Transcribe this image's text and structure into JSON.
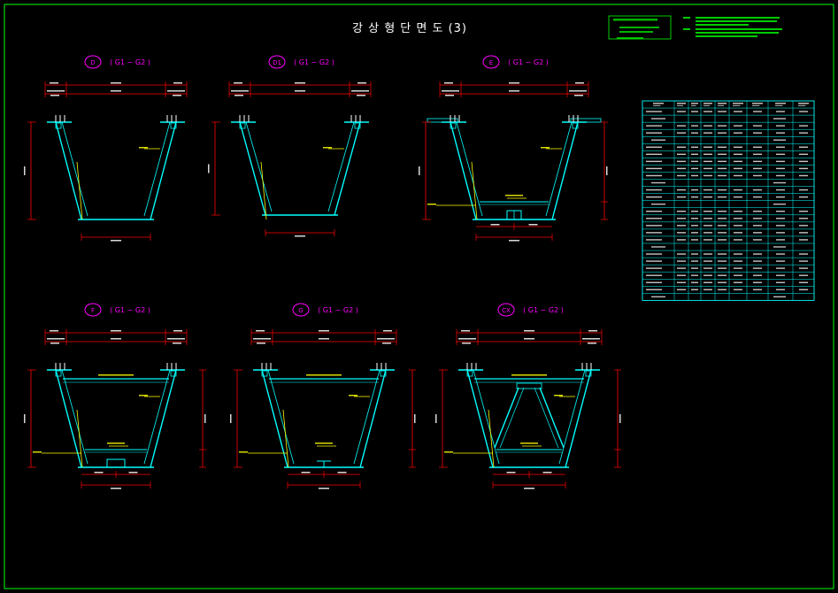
{
  "title": "강 상 형 단 면 도 (3)",
  "colors": {
    "background": "#000000",
    "frame": "#00ff00",
    "section": "#00ffff",
    "dimension": "#ff0000",
    "note": "#ffff00",
    "label": "#ff00ff",
    "table": "#00ffff",
    "text": "#ffffff"
  },
  "sections": [
    {
      "id": "sec-d",
      "mark": "D",
      "range": "( G1 ~ G2 )",
      "bracing": "none"
    },
    {
      "id": "sec-d1",
      "mark": "D1",
      "range": "( G1 ~ G2 )",
      "bracing": "none"
    },
    {
      "id": "sec-e",
      "mark": "E",
      "range": "( G1 ~ G2 )",
      "bracing": "bottom"
    },
    {
      "id": "sec-f",
      "mark": "F",
      "range": "( G1 ~ G2 )",
      "bracing": "strut-bottom"
    },
    {
      "id": "sec-g",
      "mark": "G",
      "range": "( G1 ~ G2 )",
      "bracing": "strut"
    },
    {
      "id": "sec-cx",
      "mark": "CX",
      "range": "( G1 ~ G2 )",
      "bracing": "cross"
    }
  ]
}
